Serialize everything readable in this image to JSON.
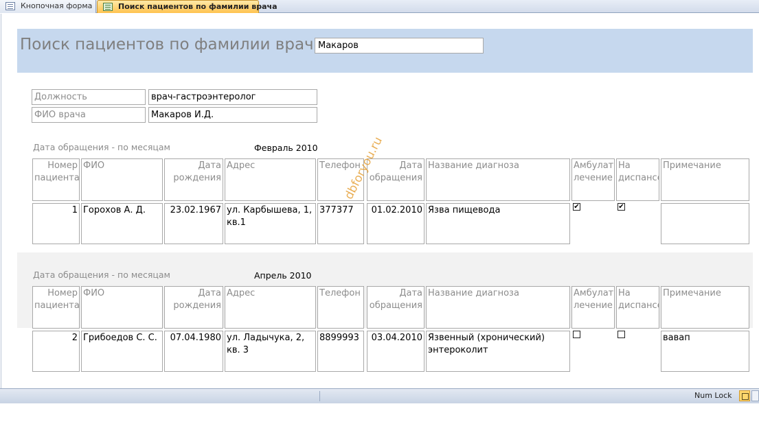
{
  "tabs": [
    {
      "label": "Кнопочная форма",
      "active": false
    },
    {
      "label": "Поиск пациентов по фамилии врача",
      "active": true
    }
  ],
  "form": {
    "title": "Поиск пациентов по фамилии врача",
    "search_value": "Макаров",
    "fields": [
      {
        "label": "Должность",
        "value": "врач-гастроэнтеролог"
      },
      {
        "label": "ФИО врача",
        "value": "Макаров И.Д."
      }
    ]
  },
  "columns": [
    "Номер пациента",
    "ФИО",
    "Дата рождения",
    "Адрес",
    "Телефон",
    "Дата обращения",
    "Название диагноза",
    "Амбулаторное лечение",
    "На диспансерном",
    "Примечание"
  ],
  "groups": [
    {
      "label": "Дата обращения - по месяцам",
      "month": "Февраль 2010",
      "rows": [
        {
          "num": "1",
          "name": "Горохов А. Д.",
          "birth": "23.02.1967",
          "address": "ул. Карбышева, 1, кв.1",
          "phone": "377377",
          "visit": "01.02.2010",
          "diagnosis": "Язва пищевода",
          "ambulatory": true,
          "dispensary": true,
          "note": ""
        }
      ]
    },
    {
      "label": "Дата обращения - по месяцам",
      "month": "Апрель 2010",
      "rows": [
        {
          "num": "2",
          "name": "Грибоедов С. С.",
          "birth": "07.04.1980",
          "address": "ул. Ладычука, 2, кв. 3",
          "phone": "8899993",
          "visit": "03.04.2010",
          "diagnosis": "Язвенный (хронический) энтероколит",
          "ambulatory": false,
          "dispensary": false,
          "note": "вавап"
        }
      ]
    }
  ],
  "watermark": "dbforyou.ru",
  "status": {
    "num_lock": "Num Lock"
  },
  "colors": {
    "header_band": "#c6d8ee",
    "active_tab": "#ffc34f",
    "group_band": "#f2f2f2"
  }
}
